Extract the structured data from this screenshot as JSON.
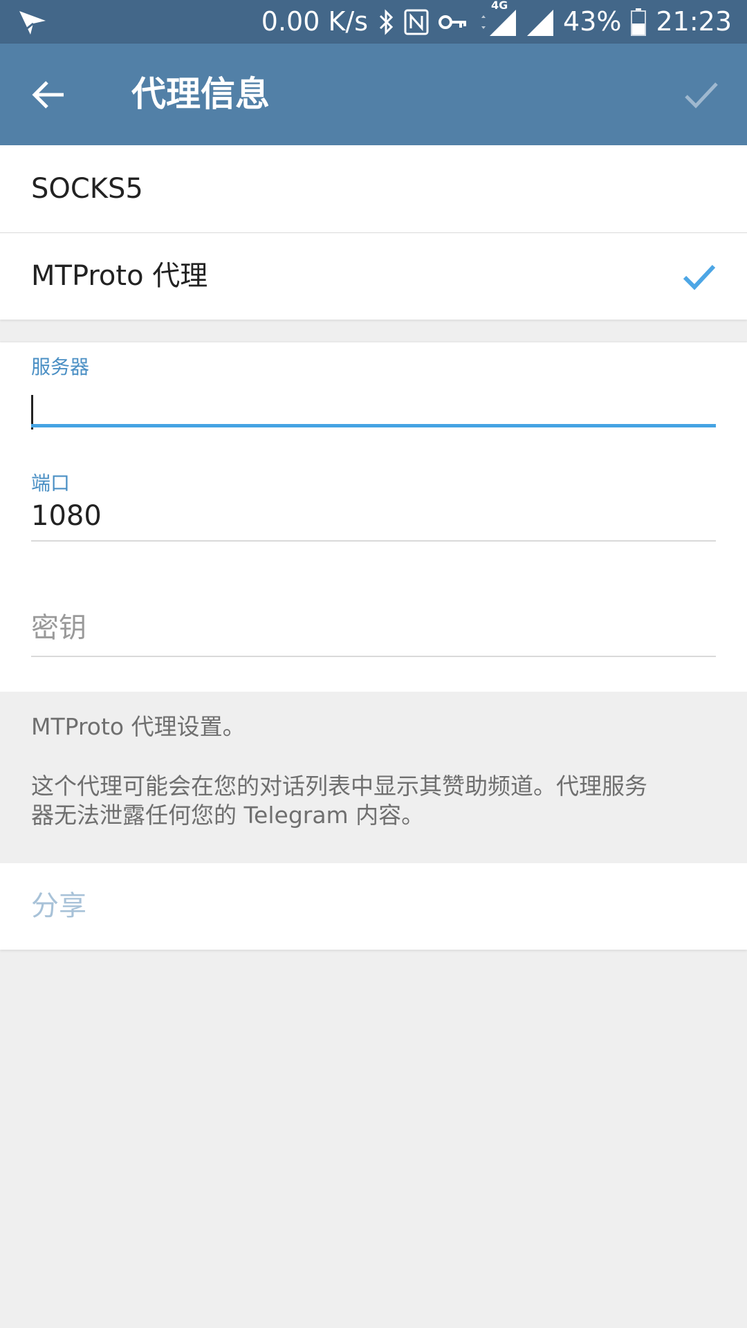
{
  "status_bar": {
    "network_speed": "0.00 K/s",
    "network_type": "4G",
    "battery": "43%",
    "time": "21:23",
    "icons": [
      "send-icon",
      "bluetooth-icon",
      "nfc-icon",
      "vpn-key-icon",
      "signal-4g-icon",
      "signal-icon",
      "battery-icon"
    ]
  },
  "toolbar": {
    "title": "代理信息",
    "back_icon": "arrow-back-icon",
    "done_icon": "checkmark-icon"
  },
  "proxy_types": [
    {
      "label": "SOCKS5",
      "selected": false
    },
    {
      "label": "MTProto 代理",
      "selected": true
    }
  ],
  "fields": {
    "server": {
      "label": "服务器",
      "value": ""
    },
    "port": {
      "label": "端口",
      "value": "1080"
    },
    "secret": {
      "placeholder": "密钥",
      "value": ""
    }
  },
  "info": {
    "line1": "MTProto 代理设置。",
    "line2": "这个代理可能会在您的对话列表中显示其赞助频道。代理服务",
    "line3": "器无法泄露任何您的 Telegram 内容。"
  },
  "share": {
    "label": "分享"
  },
  "colors": {
    "status_bar": "#436789",
    "toolbar": "#5280a7",
    "accent": "#45a3e3",
    "field_label": "#4a8fc4",
    "share_disabled": "#a8c2d8"
  }
}
